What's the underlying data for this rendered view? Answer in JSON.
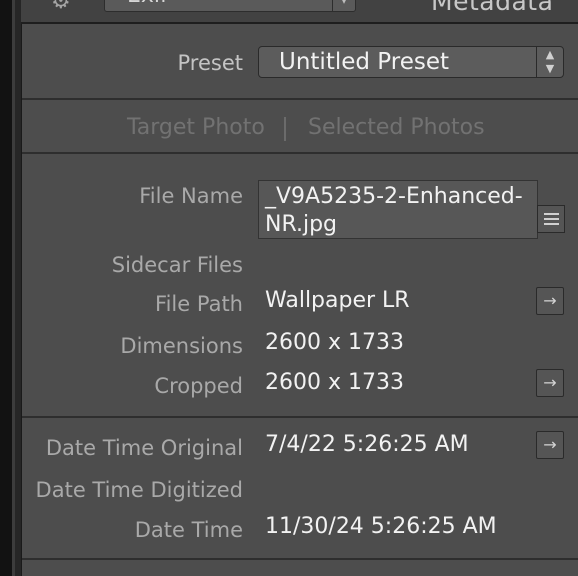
{
  "header": {
    "view_select_label": "Exif",
    "panel_title": "Metadata"
  },
  "preset": {
    "label": "Preset",
    "value": "Untitled Preset"
  },
  "target_toggle": {
    "target_photo": "Target Photo",
    "selected_photos": "Selected Photos"
  },
  "fields": {
    "file_name": {
      "label": "File Name",
      "value": "_V9A5235-2-Enhanced-NR.jpg",
      "value_line1": "_V9A5235-2-Enhanced-",
      "value_line2": "NR.jpg"
    },
    "sidecar_files": {
      "label": "Sidecar Files",
      "value": ""
    },
    "file_path": {
      "label": "File Path",
      "value": "Wallpaper LR"
    },
    "dimensions": {
      "label": "Dimensions",
      "value": "2600 x 1733"
    },
    "cropped": {
      "label": "Cropped",
      "value": "2600 x 1733"
    },
    "date_time_original": {
      "label": "Date Time Original",
      "value": "7/4/22 5:26:25 AM"
    },
    "date_time_digitized": {
      "label": "Date Time Digitized",
      "value": ""
    },
    "date_time": {
      "label": "Date Time",
      "value": "11/30/24 5:26:25 AM"
    }
  },
  "icons": {
    "gear": "gear-icon",
    "go_to": "arrow-right-icon",
    "list": "list-icon",
    "stepper": "up-down-stepper-icon"
  },
  "colors": {
    "panel_bg": "#4d4d4d",
    "text_value": "#f2f2f2",
    "text_label": "#a9a9a9",
    "text_disabled": "#727272"
  }
}
